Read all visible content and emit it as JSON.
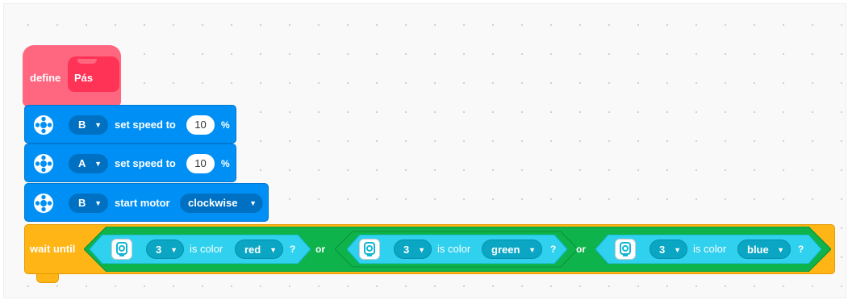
{
  "define_block": {
    "keyword": "define",
    "name": "Pás"
  },
  "motor_blocks": [
    {
      "port": "B",
      "label": "set speed to",
      "value": "10",
      "unit": "%",
      "icon": "motor-icon"
    },
    {
      "port": "A",
      "label": "set speed to",
      "value": "10",
      "unit": "%",
      "icon": "motor-icon"
    },
    {
      "port": "B",
      "label": "start motor",
      "direction": "clockwise",
      "icon": "motor-icon"
    }
  ],
  "wait_block": {
    "label": "wait until",
    "or_label": "or",
    "conditions": [
      {
        "port": "3",
        "label": "is color",
        "color": "red",
        "suffix": "?",
        "icon": "color-sensor-icon"
      },
      {
        "port": "3",
        "label": "is color",
        "color": "green",
        "suffix": "?",
        "icon": "color-sensor-icon"
      },
      {
        "port": "3",
        "label": "is color",
        "color": "blue",
        "suffix": "?",
        "icon": "color-sensor-icon"
      }
    ]
  },
  "colors": {
    "define": "#ff6680",
    "motor": "#0090f5",
    "control": "#ffb515",
    "operator": "#0fb34b",
    "sensor": "#2fd1ee"
  }
}
